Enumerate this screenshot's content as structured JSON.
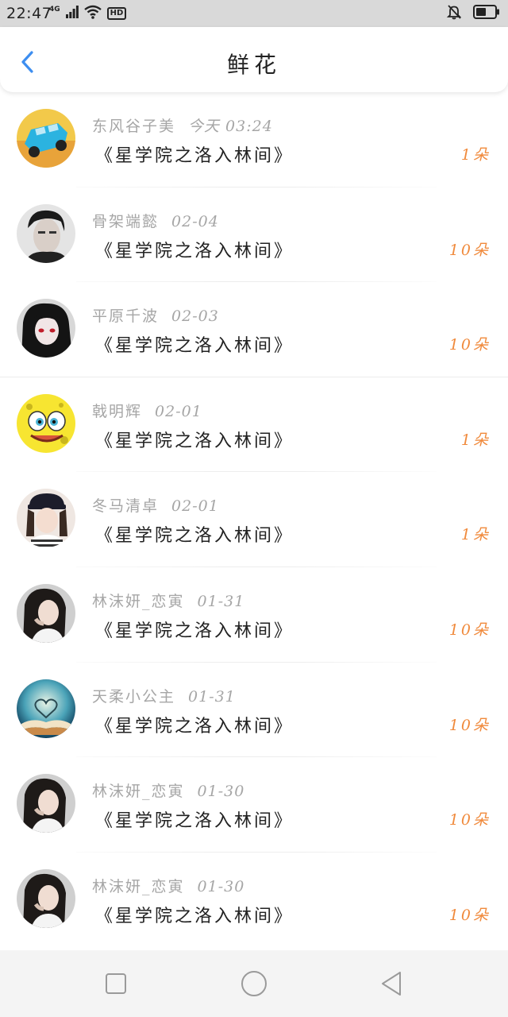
{
  "status_bar": {
    "time": "22:47",
    "network": "4G",
    "hd": "HD"
  },
  "header": {
    "title": "鲜花"
  },
  "items": [
    {
      "user": "东风谷子美",
      "date": "今天 03:24",
      "book": "《星学院之洛入林间》",
      "amount": "1朵"
    },
    {
      "user": "骨架端懿",
      "date": "02-04",
      "book": "《星学院之洛入林间》",
      "amount": "10朵"
    },
    {
      "user": "平原千波",
      "date": "02-03",
      "book": "《星学院之洛入林间》",
      "amount": "10朵"
    },
    {
      "user": "戟明辉",
      "date": "02-01",
      "book": "《星学院之洛入林间》",
      "amount": "1朵"
    },
    {
      "user": "冬马清卓",
      "date": "02-01",
      "book": "《星学院之洛入林间》",
      "amount": "1朵"
    },
    {
      "user": "林沫妍_恋寅",
      "date": "01-31",
      "book": "《星学院之洛入林间》",
      "amount": "10朵"
    },
    {
      "user": "天柔小公主",
      "date": "01-31",
      "book": "《星学院之洛入林间》",
      "amount": "10朵"
    },
    {
      "user": "林沫妍_恋寅",
      "date": "01-30",
      "book": "《星学院之洛入林间》",
      "amount": "10朵"
    },
    {
      "user": "林沫妍_恋寅",
      "date": "01-30",
      "book": "《星学院之洛入林间》",
      "amount": "10朵"
    }
  ],
  "colors": {
    "accent_blue": "#3d8ef0",
    "amount_orange": "#f08a3c",
    "meta_gray": "#a6a6a6"
  },
  "icons": {
    "back": "chevron-left-icon",
    "recent": "square-icon",
    "home": "circle-icon",
    "nav_back": "triangle-left-icon"
  }
}
